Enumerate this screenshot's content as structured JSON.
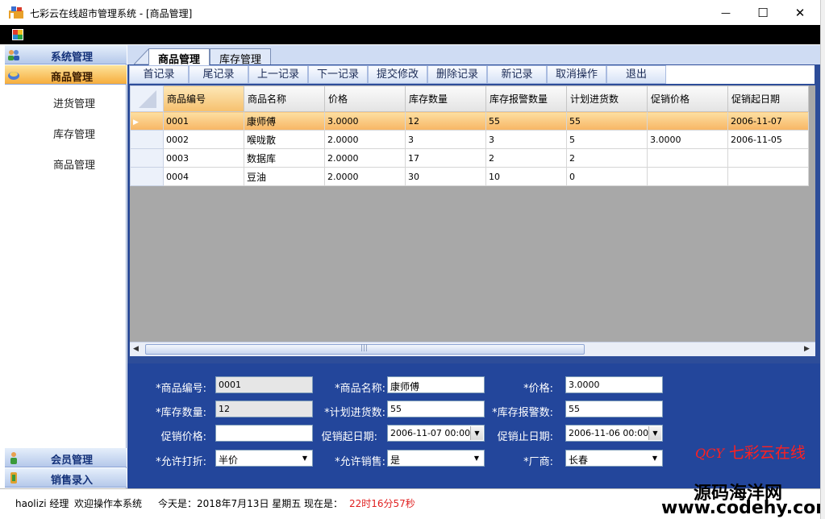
{
  "window": {
    "title": "七彩云在线超市管理系统 - [商品管理]",
    "minimize": "—",
    "maximize": "☐",
    "close": "✕"
  },
  "sidebar": {
    "groups": [
      {
        "label": "系统管理",
        "icon": "users-icon"
      },
      {
        "label": "商品管理",
        "icon": "goods-icon"
      },
      {
        "label": "会员管理",
        "icon": "member-icon"
      },
      {
        "label": "销售录入",
        "icon": "sales-icon"
      }
    ],
    "items": [
      {
        "label": "进货管理"
      },
      {
        "label": "库存管理"
      },
      {
        "label": "商品管理"
      }
    ]
  },
  "tabs": [
    {
      "label": "商品管理"
    },
    {
      "label": "库存管理"
    }
  ],
  "toolbar": {
    "buttons": [
      {
        "label": "首记录"
      },
      {
        "label": "尾记录"
      },
      {
        "label": "上一记录"
      },
      {
        "label": "下一记录"
      },
      {
        "label": "提交修改"
      },
      {
        "label": "删除记录"
      },
      {
        "label": "新记录"
      },
      {
        "label": "取消操作"
      },
      {
        "label": "退出"
      }
    ]
  },
  "grid": {
    "columns": [
      "商品编号",
      "商品名称",
      "价格",
      "库存数量",
      "库存报警数量",
      "计划进货数",
      "促销价格",
      "促销起日期"
    ],
    "rows": [
      [
        "0001",
        "康师傅",
        "3.0000",
        "12",
        "55",
        "55",
        "",
        "2006-11-07"
      ],
      [
        "0002",
        "喉咙散",
        "2.0000",
        "3",
        "3",
        "5",
        "3.0000",
        "2006-11-05"
      ],
      [
        "0003",
        "数据库",
        "2.0000",
        "17",
        "2",
        "2",
        "",
        ""
      ],
      [
        "0004",
        "豆油",
        "2.0000",
        "30",
        "10",
        "0",
        "",
        ""
      ]
    ],
    "selected_row": 0
  },
  "form": {
    "goods_id_label": "*商品编号:",
    "goods_id": "0001",
    "goods_name_label": "*商品名称:",
    "goods_name": "康师傅",
    "price_label": "*价格:",
    "price": "3.0000",
    "stock_label": "*库存数量:",
    "stock": "12",
    "plan_label": "*计划进货数:",
    "plan": "55",
    "alarm_label": "*库存报警数:",
    "alarm": "55",
    "promo_price_label": "促销价格:",
    "promo_price": "",
    "promo_start_label": "促销起日期:",
    "promo_start": "2006-11-07 00:00",
    "promo_end_label": "促销止日期:",
    "promo_end": "2006-11-06 00:00",
    "discount_label": "*允许打折:",
    "discount": "半价",
    "allow_sale_label": "*允许销售:",
    "allow_sale": "是",
    "vendor_label": "*厂商:",
    "vendor": "长春"
  },
  "logo": {
    "mark": "QCY",
    "text": "七彩云在线"
  },
  "status": {
    "user": "haolizi 经理",
    "welcome": "欢迎操作本系统",
    "today": "今天是：2018年7月13日 星期五",
    "now_label": "现在是：",
    "time": "22时16分57秒"
  },
  "watermark": {
    "line1": "源码海洋网",
    "line2": "www.codehy.com"
  },
  "colors": {
    "accent": "#f6ad3d",
    "panel": "#23469b",
    "time": "#e02020"
  }
}
